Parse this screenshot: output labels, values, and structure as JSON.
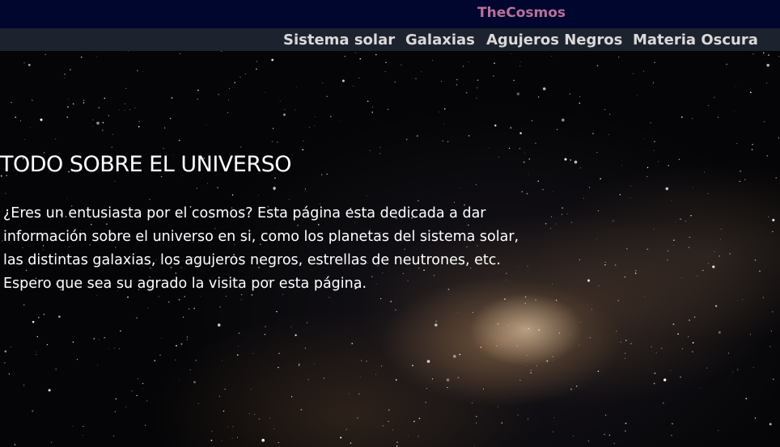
{
  "header": {
    "brand": "TheCosmos"
  },
  "nav": {
    "items": [
      "Sistema solar",
      "Galaxias",
      "Agujeros Negros",
      "Materia Oscura"
    ]
  },
  "hero": {
    "title": "TODO SOBRE EL UNIVERSO",
    "lines": [
      "¿Eres un entusiasta por el cosmos? Esta página esta dedicada a dar",
      "información sobre el universo en si, como los planetas del sistema solar,",
      "las distintas galaxias, los agujeros negros, estrellas de neutrones, etc.",
      "Espero que sea su agrado la visita por esta página."
    ]
  }
}
